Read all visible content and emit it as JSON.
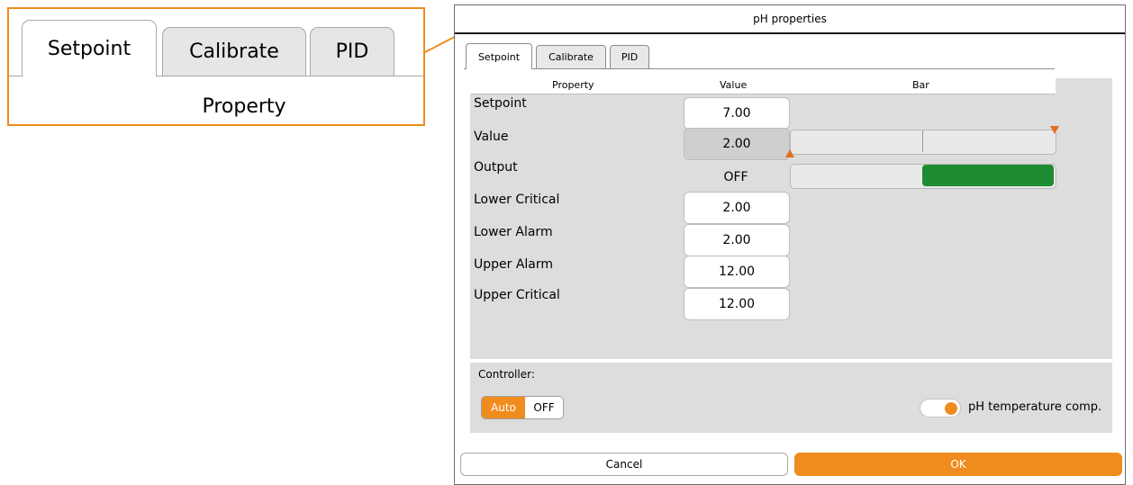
{
  "zoom": {
    "tabs": [
      "Setpoint",
      "Calibrate",
      "PID"
    ],
    "property_header": "Property"
  },
  "dialog": {
    "title": "pH properties",
    "tabs": [
      {
        "label": "Setpoint",
        "active": true
      },
      {
        "label": "Calibrate",
        "active": false
      },
      {
        "label": "PID",
        "active": false
      }
    ],
    "columns": {
      "property": "Property",
      "value": "Value",
      "bar": "Bar"
    },
    "rows": [
      {
        "label": "Setpoint",
        "value": "7.00"
      },
      {
        "label": "Value",
        "value": "2.00"
      },
      {
        "label": "Output",
        "value": "OFF"
      },
      {
        "label": "Lower Critical",
        "value": "2.00"
      },
      {
        "label": "Lower Alarm",
        "value": "2.00"
      },
      {
        "label": "Upper Alarm",
        "value": "12.00"
      },
      {
        "label": "Upper Critical",
        "value": "12.00"
      }
    ],
    "value_bar": {
      "marker_fraction": 0.5
    },
    "output_bar": {
      "fill_start_fraction": 0.5,
      "fill_end_fraction": 1.0
    },
    "controller": {
      "label": "Controller:",
      "mode_selected": "Auto",
      "mode_other": "OFF",
      "temp_comp_label": "pH temperature comp.",
      "temp_comp_enabled": true
    },
    "buttons": {
      "cancel": "Cancel",
      "ok": "OK"
    }
  },
  "colors": {
    "accent": "#f08c1e",
    "output_fill": "#1e8c32"
  }
}
